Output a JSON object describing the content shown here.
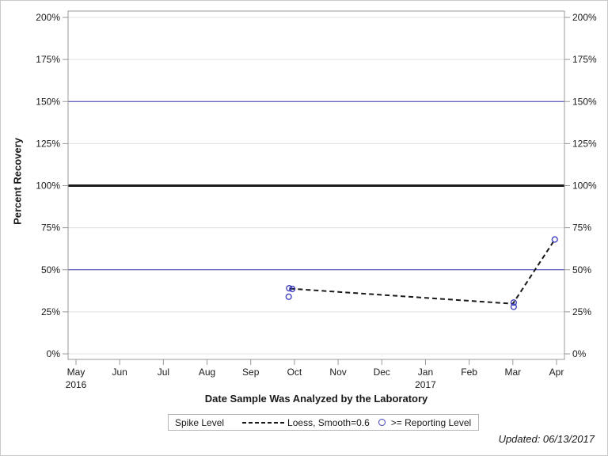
{
  "chart_data": {
    "type": "scatter",
    "title": "",
    "xlabel": "Date Sample Was Analyzed by the Laboratory",
    "ylabel": "Percent Recovery",
    "footnote": "Updated: 06/13/2017",
    "ylim": [
      0,
      200
    ],
    "xlim_month_index": [
      -0.18,
      11.18
    ],
    "grid": "horizontal-only",
    "legend_position": "bottom-center",
    "x_ticks": [
      {
        "label": "May",
        "year": "2016"
      },
      {
        "label": "Jun"
      },
      {
        "label": "Jul"
      },
      {
        "label": "Aug"
      },
      {
        "label": "Sep"
      },
      {
        "label": "Oct"
      },
      {
        "label": "Nov"
      },
      {
        "label": "Dec"
      },
      {
        "label": "Jan",
        "year": "2017"
      },
      {
        "label": "Feb"
      },
      {
        "label": "Mar"
      },
      {
        "label": "Apr"
      }
    ],
    "y_ticks": [
      {
        "value": 0,
        "label": "0%"
      },
      {
        "value": 25,
        "label": "25%"
      },
      {
        "value": 50,
        "label": "50%"
      },
      {
        "value": 75,
        "label": "75%"
      },
      {
        "value": 100,
        "label": "100%"
      },
      {
        "value": 125,
        "label": "125%"
      },
      {
        "value": 150,
        "label": "150%"
      },
      {
        "value": 175,
        "label": "175%"
      },
      {
        "value": 200,
        "label": "200%"
      }
    ],
    "gridline_values": [
      0,
      25,
      50,
      75,
      100,
      125,
      150,
      175,
      200
    ],
    "reference_lines": [
      {
        "value": 150,
        "color": "#3a3ab3",
        "width": 1
      },
      {
        "value": 100,
        "color": "#1a1a1a",
        "width": 3
      },
      {
        "value": 50,
        "color": "#3a3ab3",
        "width": 1
      }
    ],
    "legend": {
      "title": "Spike Level",
      "loess_label": "Loess, Smooth=0.6",
      "marker_label": ">= Reporting Level"
    },
    "loess": {
      "name": "Loess, Smooth=0.6",
      "points_month_pct": [
        [
          4.9,
          38.8
        ],
        [
          10.0,
          29.8
        ],
        [
          10.96,
          68.0
        ]
      ]
    },
    "markers": {
      "name": ">= Reporting Level",
      "points_month_pct": [
        [
          4.88,
          39.0
        ],
        [
          4.95,
          38.6
        ],
        [
          4.87,
          34.0
        ],
        [
          10.02,
          30.5
        ],
        [
          10.02,
          28.0
        ],
        [
          10.96,
          68.0
        ]
      ]
    },
    "colors": {
      "gridline": "#e0e0e0",
      "axis": "#999999",
      "tick_text": "#1a1a1a",
      "reference_blue": "#3a3ab3",
      "reference_black": "#1a1a1a",
      "loess": "#1a1a1a",
      "marker": "#4040c0"
    }
  }
}
